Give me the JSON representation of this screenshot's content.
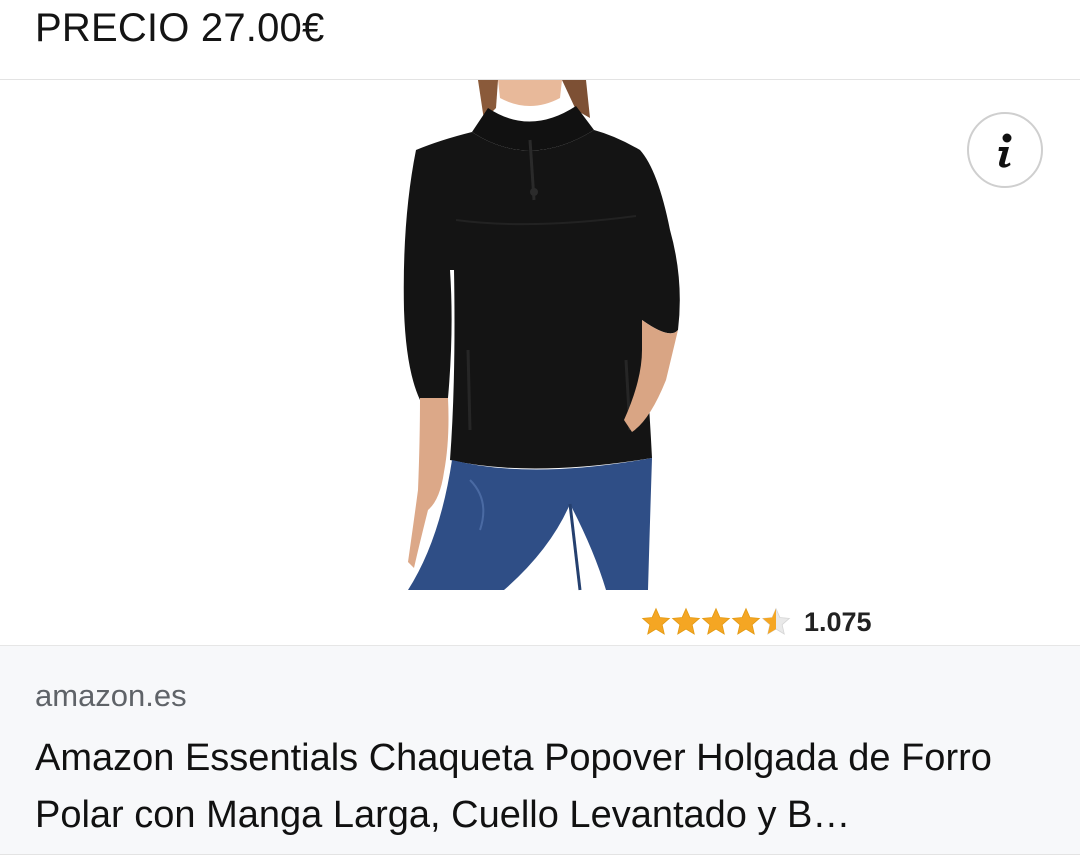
{
  "header": {
    "price_label": "PRECIO 27.00€"
  },
  "product": {
    "image_icon": "product-photo-black-fleece-jacket",
    "info_icon": "info-icon",
    "rating": {
      "stars": 4.5,
      "max_stars": 5,
      "star_color": "#f5a623",
      "count": "1.075"
    }
  },
  "listing": {
    "source": "amazon.es",
    "title": "Amazon Essentials Chaqueta Popover Holgada de Forro Polar con Manga Larga, Cuello Levantado y B…"
  }
}
